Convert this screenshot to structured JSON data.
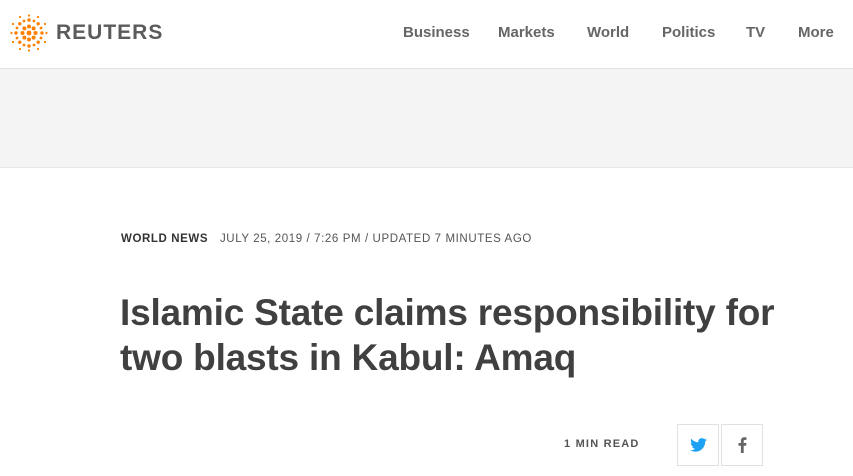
{
  "brand": {
    "name": "REUTERS",
    "accent": "#ff8000"
  },
  "nav": {
    "items": [
      {
        "label": "Business"
      },
      {
        "label": "Markets"
      },
      {
        "label": "World"
      },
      {
        "label": "Politics"
      },
      {
        "label": "TV"
      },
      {
        "label": "More"
      }
    ]
  },
  "article": {
    "section": "WORLD NEWS",
    "dateline": "JULY 25, 2019 / 7:26 PM / UPDATED 7 MINUTES AGO",
    "headline": "Islamic State claims responsibility for two blasts in Kabul: Amaq",
    "read_time": "1 MIN READ"
  },
  "share": {
    "twitter_icon": "twitter-icon",
    "twitter_color": "#1da1f2",
    "facebook_icon": "facebook-icon",
    "facebook_color": "#666666"
  }
}
